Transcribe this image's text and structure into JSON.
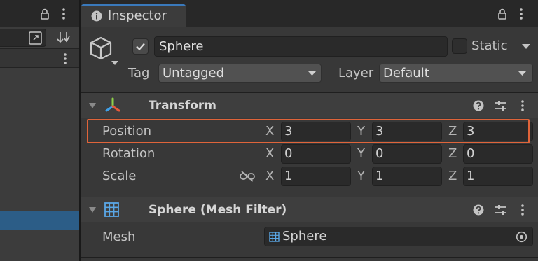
{
  "inspector": {
    "tab_title": "Inspector",
    "object": {
      "name": "Sphere",
      "active": true,
      "static_label": "Static"
    },
    "tag": {
      "label": "Tag",
      "value": "Untagged"
    },
    "layer": {
      "label": "Layer",
      "value": "Default"
    }
  },
  "transform": {
    "title": "Transform",
    "rows": [
      {
        "label": "Position",
        "x": "3",
        "y": "3",
        "z": "3"
      },
      {
        "label": "Rotation",
        "x": "0",
        "y": "0",
        "z": "0"
      },
      {
        "label": "Scale",
        "x": "1",
        "y": "1",
        "z": "1"
      }
    ],
    "axes": {
      "x": "X",
      "y": "Y",
      "z": "Z"
    }
  },
  "mesh_filter": {
    "title": "Sphere (Mesh Filter)",
    "mesh_label": "Mesh",
    "mesh_value": "Sphere"
  },
  "colors": {
    "accent_tab": "#3a79bb",
    "selection": "#2c5d87",
    "highlight_box": "#e0643a"
  }
}
